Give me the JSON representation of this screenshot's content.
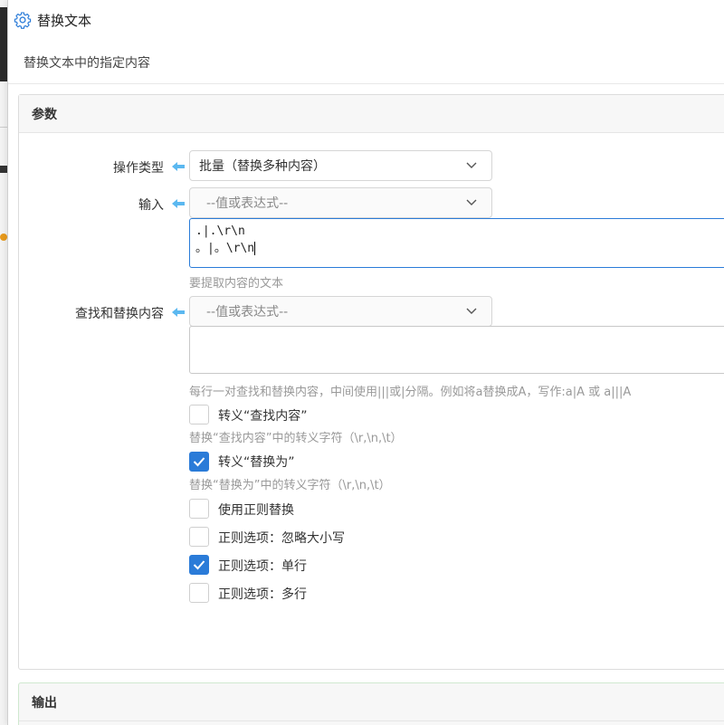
{
  "dialog": {
    "title": "替换文本",
    "subtitle": "替换文本中的指定内容"
  },
  "params": {
    "header": "参数",
    "operation_type": {
      "label": "操作类型",
      "value": "批量（替换多种内容）"
    },
    "input": {
      "label": "输入",
      "select_placeholder": "--值或表达式--",
      "text_line1": ".|.\\r\\n",
      "text_line2": "。|。\\r\\n",
      "hint": "要提取内容的文本"
    },
    "find_replace": {
      "label": "查找和替换内容",
      "select_placeholder": "--值或表达式--",
      "hint": "每行一对查找和替换内容，中间使用|||或|分隔。例如将a替换成A，写作:a|A 或 a|||A"
    },
    "options": [
      {
        "label": "转义“查找内容”",
        "checked": false,
        "hint": "替换“查找内容”中的转义字符（\\r,\\n,\\t）"
      },
      {
        "label": "转义“替换为”",
        "checked": true,
        "hint": "替换“替换为”中的转义字符（\\r,\\n,\\t）"
      },
      {
        "label": "使用正则替换",
        "checked": false,
        "hint": ""
      },
      {
        "label": "正则选项：忽略大小写",
        "checked": false,
        "hint": ""
      },
      {
        "label": "正则选项：单行",
        "checked": true,
        "hint": ""
      },
      {
        "label": "正则选项：多行",
        "checked": false,
        "hint": ""
      }
    ]
  },
  "output": {
    "header": "输出"
  },
  "colors": {
    "accent": "#2a7bd8",
    "arrow": "#5bb8f0",
    "hint": "#999999"
  },
  "icons": {
    "title": "gear-icon",
    "field_link": "left-arrow-icon",
    "dropdown": "chevron-down-icon",
    "check": "checkmark-icon"
  }
}
